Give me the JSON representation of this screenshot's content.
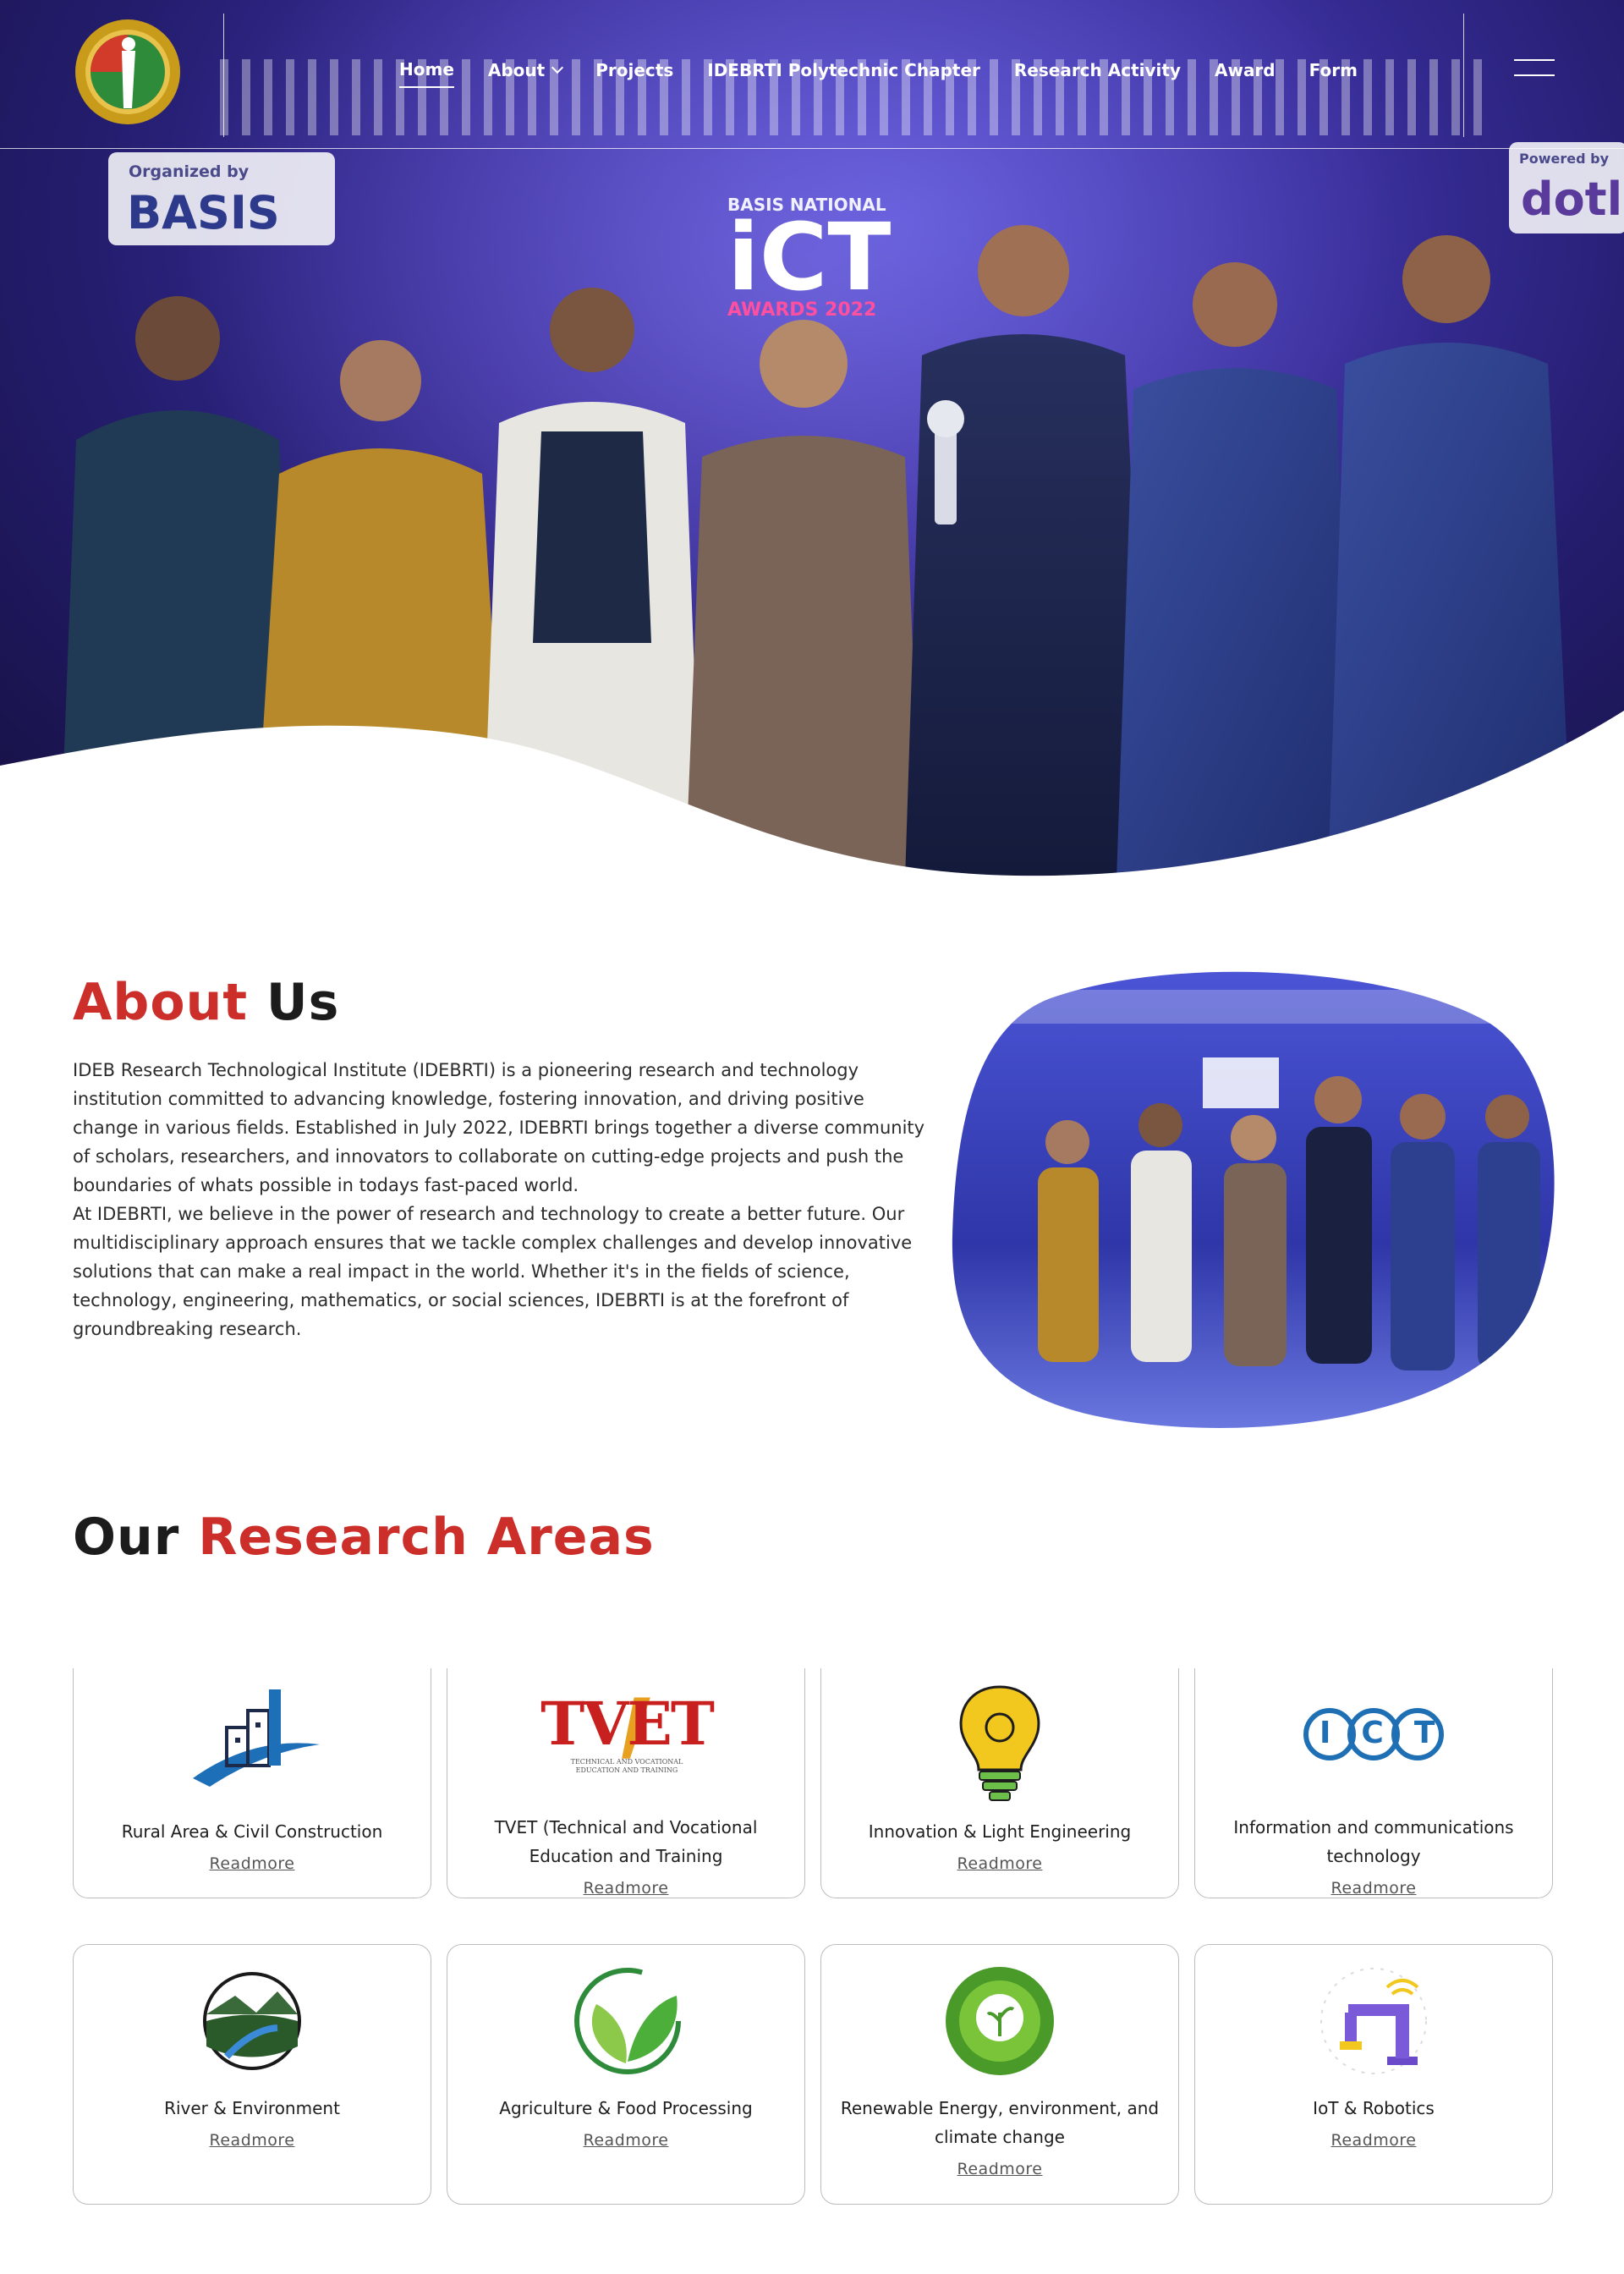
{
  "nav": {
    "items": [
      {
        "label": "Home",
        "active": true
      },
      {
        "label": "About",
        "dropdown": true
      },
      {
        "label": "Projects"
      },
      {
        "label": "IDEBRTI Polytechnic Chapter"
      },
      {
        "label": "Research Activity"
      },
      {
        "label": "Award"
      },
      {
        "label": "Form"
      }
    ]
  },
  "hero": {
    "banner_left_top": "Organized by",
    "banner_left_brand": "BASIS",
    "banner_right_top": "Powered by",
    "banner_right_brand": "dotl",
    "event_logo_top": "BASIS NATIONAL",
    "event_logo_main": "iCT",
    "event_logo_bottom": "AWARDS 2022"
  },
  "about": {
    "title_part1": "About",
    "title_part2": "Us",
    "para1": "IDEB Research Technological Institute (IDEBRTI) is a pioneering research and technology institution committed to advancing knowledge, fostering innovation, and driving positive change in various fields. Established in July 2022, IDEBRTI brings together a diverse community of scholars, researchers, and innovators to collaborate on cutting-edge projects and push the boundaries of whats possible in todays fast-paced world.",
    "para2": "At IDEBRTI, we believe in the power of research and technology to create a better future. Our multidisciplinary approach ensures that we tackle complex challenges and develop innovative solutions that can make a real impact in the world. Whether it's in the fields of science, technology, engineering, mathematics, or social sciences, IDEBRTI is at the forefront of groundbreaking research."
  },
  "research": {
    "title_part1": "Our",
    "title_part2": "Research Areas",
    "readmore": "Readmore",
    "cards": [
      {
        "title": "Rural Area & Civil Construction",
        "icon": "building-icon"
      },
      {
        "title": "TVET (Technical and Vocational Education and Training",
        "icon": "tvet-logo-icon",
        "logo_text": "TVET",
        "logo_subtext": "TECHNICAL AND VOCATIONAL EDUCATION AND TRAINING"
      },
      {
        "title": "Innovation & Light Engineering",
        "icon": "lightbulb-icon"
      },
      {
        "title": "Information and communications technology",
        "icon": "ict-icon",
        "logo_text": "ICT"
      },
      {
        "title": "River & Environment",
        "icon": "river-icon"
      },
      {
        "title": "Agriculture & Food Processing",
        "icon": "leaf-icon"
      },
      {
        "title": "Renewable Energy, environment, and climate change",
        "icon": "eco-globe-icon"
      },
      {
        "title": "IoT & Robotics",
        "icon": "robot-arm-icon"
      }
    ]
  },
  "colors": {
    "accent_red": "#cc2e2a",
    "hero_purple": "#3a2f9e",
    "text_dark": "#1c1c1c"
  }
}
